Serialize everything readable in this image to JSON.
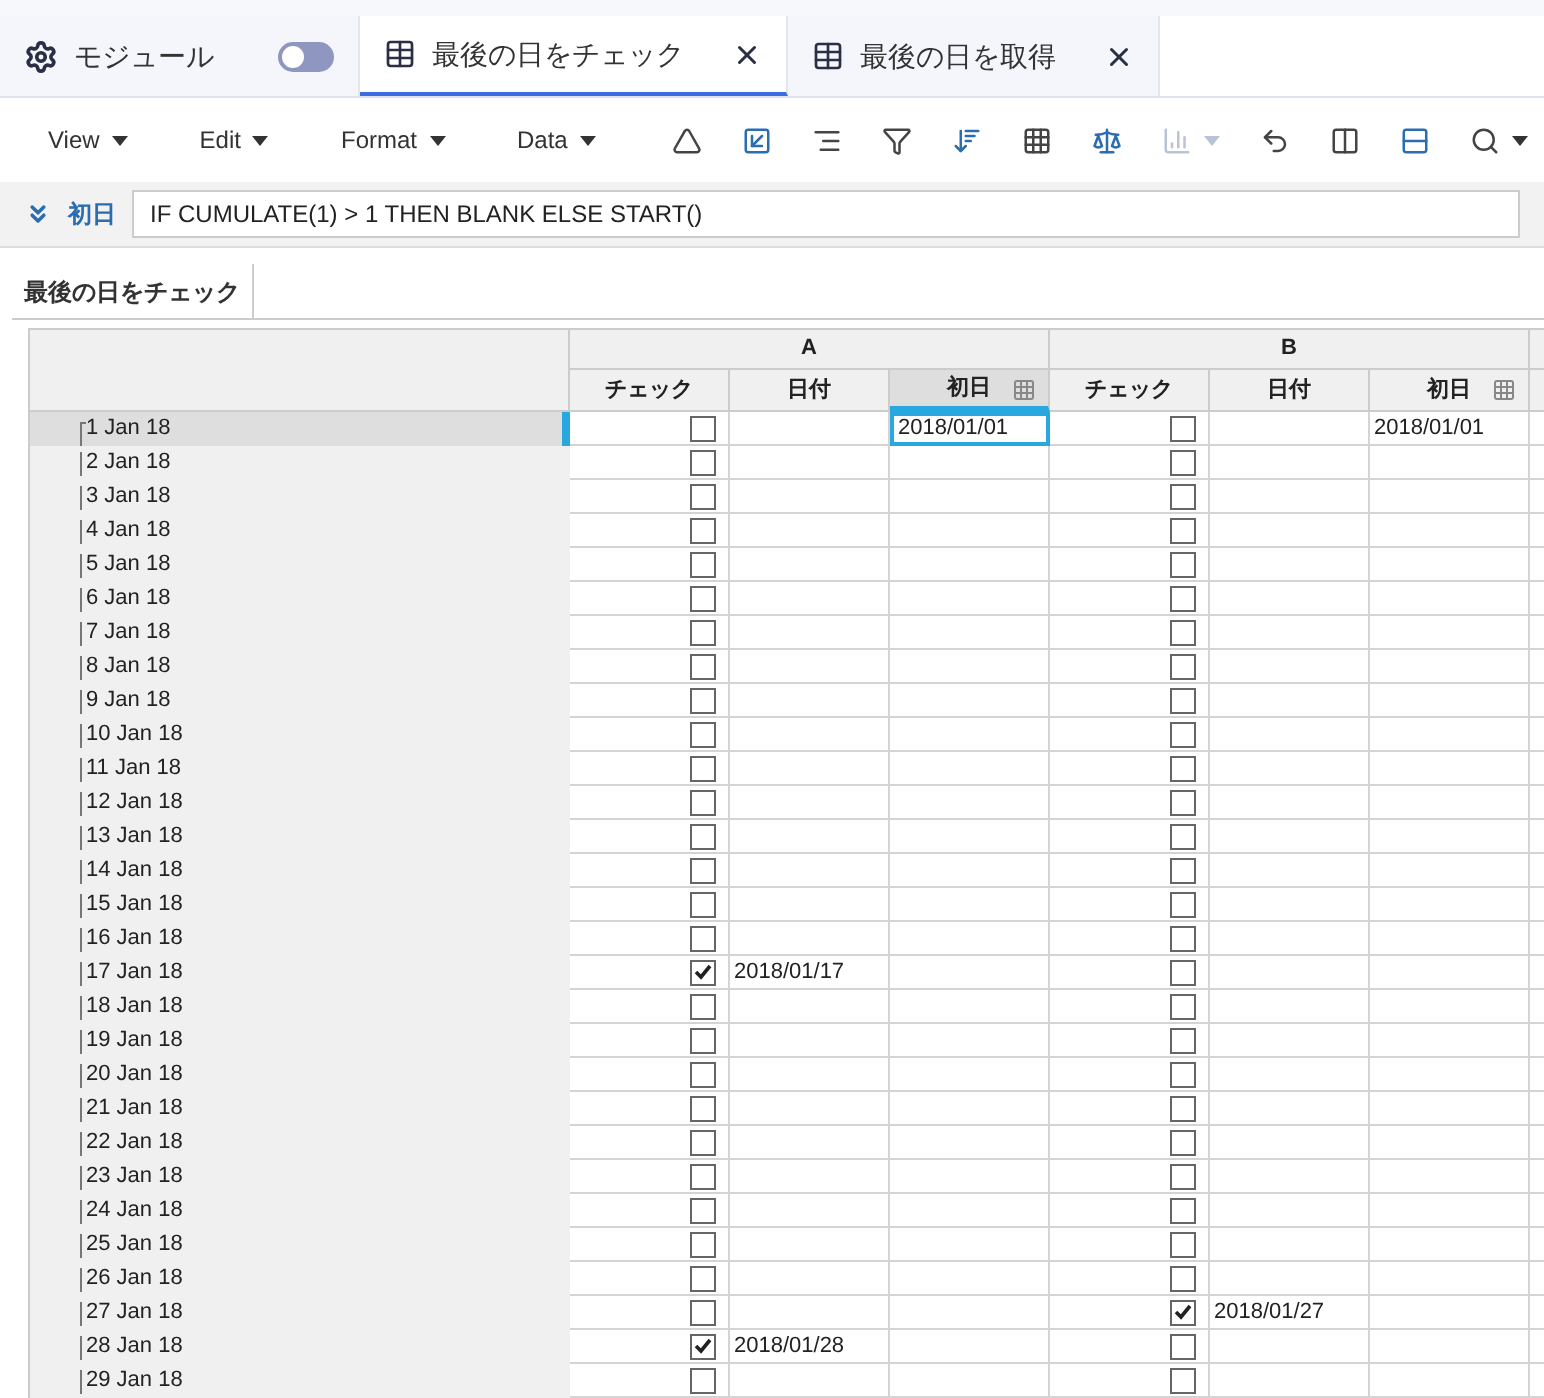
{
  "tabs": [
    {
      "kind": "module",
      "label": "モジュール",
      "toggle_on": false,
      "selected": false
    },
    {
      "kind": "sheet",
      "label": "最後の日をチェック",
      "selected": true
    },
    {
      "kind": "sheet",
      "label": "最後の日を取得",
      "selected": false
    }
  ],
  "menus": [
    "View",
    "Edit",
    "Format",
    "Data"
  ],
  "tools": [
    {
      "kind": "triangle",
      "disabled": false
    },
    {
      "kind": "frame",
      "disabled": false
    },
    {
      "kind": "lines",
      "disabled": false
    },
    {
      "kind": "filter",
      "disabled": false
    },
    {
      "kind": "sort",
      "disabled": false
    },
    {
      "kind": "grid",
      "disabled": false
    },
    {
      "kind": "scale",
      "disabled": false
    },
    {
      "kind": "chart",
      "disabled": true
    },
    {
      "kind": "undo",
      "disabled": false
    },
    {
      "kind": "column",
      "disabled": false
    },
    {
      "kind": "row",
      "disabled": false
    },
    {
      "kind": "search",
      "disabled": false
    }
  ],
  "formula": {
    "label": "初日",
    "value": "IF CUMULATE(1) > 1 THEN BLANK ELSE START()"
  },
  "sheet_tab": "最後の日をチェック",
  "groups": [
    "A",
    "B"
  ],
  "columns": [
    {
      "label": "チェック",
      "selected": false
    },
    {
      "label": "日付",
      "selected": false
    },
    {
      "label": "初日",
      "selected": true
    },
    {
      "label": "チェック",
      "selected": false
    },
    {
      "label": "日付",
      "selected": false
    },
    {
      "label": "初日",
      "selected": false
    }
  ],
  "rows": [
    {
      "label": "1 Jan 18",
      "selected": true,
      "cells": [
        {
          "kind": "check",
          "checked": false
        },
        {
          "kind": "text",
          "selected": false
        },
        {
          "kind": "text",
          "text": "2018/01/01",
          "selected": true
        },
        {
          "kind": "check",
          "checked": false
        },
        {
          "kind": "text",
          "selected": false
        },
        {
          "kind": "text",
          "text": "2018/01/01",
          "selected": false
        }
      ]
    },
    {
      "label": "2 Jan 18",
      "selected": false,
      "cells": [
        {
          "kind": "check",
          "checked": false
        },
        {
          "kind": "text",
          "selected": false
        },
        {
          "kind": "text",
          "selected": false
        },
        {
          "kind": "check",
          "checked": false
        },
        {
          "kind": "text",
          "selected": false
        },
        {
          "kind": "text",
          "selected": false
        }
      ]
    },
    {
      "label": "3 Jan 18",
      "selected": false,
      "cells": [
        {
          "kind": "check",
          "checked": false
        },
        {
          "kind": "text",
          "selected": false
        },
        {
          "kind": "text",
          "selected": false
        },
        {
          "kind": "check",
          "checked": false
        },
        {
          "kind": "text",
          "selected": false
        },
        {
          "kind": "text",
          "selected": false
        }
      ]
    },
    {
      "label": "4 Jan 18",
      "selected": false,
      "cells": [
        {
          "kind": "check",
          "checked": false
        },
        {
          "kind": "text",
          "selected": false
        },
        {
          "kind": "text",
          "selected": false
        },
        {
          "kind": "check",
          "checked": false
        },
        {
          "kind": "text",
          "selected": false
        },
        {
          "kind": "text",
          "selected": false
        }
      ]
    },
    {
      "label": "5 Jan 18",
      "selected": false,
      "cells": [
        {
          "kind": "check",
          "checked": false
        },
        {
          "kind": "text",
          "selected": false
        },
        {
          "kind": "text",
          "selected": false
        },
        {
          "kind": "check",
          "checked": false
        },
        {
          "kind": "text",
          "selected": false
        },
        {
          "kind": "text",
          "selected": false
        }
      ]
    },
    {
      "label": "6 Jan 18",
      "selected": false,
      "cells": [
        {
          "kind": "check",
          "checked": false
        },
        {
          "kind": "text",
          "selected": false
        },
        {
          "kind": "text",
          "selected": false
        },
        {
          "kind": "check",
          "checked": false
        },
        {
          "kind": "text",
          "selected": false
        },
        {
          "kind": "text",
          "selected": false
        }
      ]
    },
    {
      "label": "7 Jan 18",
      "selected": false,
      "cells": [
        {
          "kind": "check",
          "checked": false
        },
        {
          "kind": "text",
          "selected": false
        },
        {
          "kind": "text",
          "selected": false
        },
        {
          "kind": "check",
          "checked": false
        },
        {
          "kind": "text",
          "selected": false
        },
        {
          "kind": "text",
          "selected": false
        }
      ]
    },
    {
      "label": "8 Jan 18",
      "selected": false,
      "cells": [
        {
          "kind": "check",
          "checked": false
        },
        {
          "kind": "text",
          "selected": false
        },
        {
          "kind": "text",
          "selected": false
        },
        {
          "kind": "check",
          "checked": false
        },
        {
          "kind": "text",
          "selected": false
        },
        {
          "kind": "text",
          "selected": false
        }
      ]
    },
    {
      "label": "9 Jan 18",
      "selected": false,
      "cells": [
        {
          "kind": "check",
          "checked": false
        },
        {
          "kind": "text",
          "selected": false
        },
        {
          "kind": "text",
          "selected": false
        },
        {
          "kind": "check",
          "checked": false
        },
        {
          "kind": "text",
          "selected": false
        },
        {
          "kind": "text",
          "selected": false
        }
      ]
    },
    {
      "label": "10 Jan 18",
      "selected": false,
      "cells": [
        {
          "kind": "check",
          "checked": false
        },
        {
          "kind": "text",
          "selected": false
        },
        {
          "kind": "text",
          "selected": false
        },
        {
          "kind": "check",
          "checked": false
        },
        {
          "kind": "text",
          "selected": false
        },
        {
          "kind": "text",
          "selected": false
        }
      ]
    },
    {
      "label": "11 Jan 18",
      "selected": false,
      "cells": [
        {
          "kind": "check",
          "checked": false
        },
        {
          "kind": "text",
          "selected": false
        },
        {
          "kind": "text",
          "selected": false
        },
        {
          "kind": "check",
          "checked": false
        },
        {
          "kind": "text",
          "selected": false
        },
        {
          "kind": "text",
          "selected": false
        }
      ]
    },
    {
      "label": "12 Jan 18",
      "selected": false,
      "cells": [
        {
          "kind": "check",
          "checked": false
        },
        {
          "kind": "text",
          "selected": false
        },
        {
          "kind": "text",
          "selected": false
        },
        {
          "kind": "check",
          "checked": false
        },
        {
          "kind": "text",
          "selected": false
        },
        {
          "kind": "text",
          "selected": false
        }
      ]
    },
    {
      "label": "13 Jan 18",
      "selected": false,
      "cells": [
        {
          "kind": "check",
          "checked": false
        },
        {
          "kind": "text",
          "selected": false
        },
        {
          "kind": "text",
          "selected": false
        },
        {
          "kind": "check",
          "checked": false
        },
        {
          "kind": "text",
          "selected": false
        },
        {
          "kind": "text",
          "selected": false
        }
      ]
    },
    {
      "label": "14 Jan 18",
      "selected": false,
      "cells": [
        {
          "kind": "check",
          "checked": false
        },
        {
          "kind": "text",
          "selected": false
        },
        {
          "kind": "text",
          "selected": false
        },
        {
          "kind": "check",
          "checked": false
        },
        {
          "kind": "text",
          "selected": false
        },
        {
          "kind": "text",
          "selected": false
        }
      ]
    },
    {
      "label": "15 Jan 18",
      "selected": false,
      "cells": [
        {
          "kind": "check",
          "checked": false
        },
        {
          "kind": "text",
          "selected": false
        },
        {
          "kind": "text",
          "selected": false
        },
        {
          "kind": "check",
          "checked": false
        },
        {
          "kind": "text",
          "selected": false
        },
        {
          "kind": "text",
          "selected": false
        }
      ]
    },
    {
      "label": "16 Jan 18",
      "selected": false,
      "cells": [
        {
          "kind": "check",
          "checked": false
        },
        {
          "kind": "text",
          "selected": false
        },
        {
          "kind": "text",
          "selected": false
        },
        {
          "kind": "check",
          "checked": false
        },
        {
          "kind": "text",
          "selected": false
        },
        {
          "kind": "text",
          "selected": false
        }
      ]
    },
    {
      "label": "17 Jan 18",
      "selected": false,
      "cells": [
        {
          "kind": "check",
          "checked": true
        },
        {
          "kind": "text",
          "text": "2018/01/17",
          "selected": false
        },
        {
          "kind": "text",
          "selected": false
        },
        {
          "kind": "check",
          "checked": false
        },
        {
          "kind": "text",
          "selected": false
        },
        {
          "kind": "text",
          "selected": false
        }
      ]
    },
    {
      "label": "18 Jan 18",
      "selected": false,
      "cells": [
        {
          "kind": "check",
          "checked": false
        },
        {
          "kind": "text",
          "selected": false
        },
        {
          "kind": "text",
          "selected": false
        },
        {
          "kind": "check",
          "checked": false
        },
        {
          "kind": "text",
          "selected": false
        },
        {
          "kind": "text",
          "selected": false
        }
      ]
    },
    {
      "label": "19 Jan 18",
      "selected": false,
      "cells": [
        {
          "kind": "check",
          "checked": false
        },
        {
          "kind": "text",
          "selected": false
        },
        {
          "kind": "text",
          "selected": false
        },
        {
          "kind": "check",
          "checked": false
        },
        {
          "kind": "text",
          "selected": false
        },
        {
          "kind": "text",
          "selected": false
        }
      ]
    },
    {
      "label": "20 Jan 18",
      "selected": false,
      "cells": [
        {
          "kind": "check",
          "checked": false
        },
        {
          "kind": "text",
          "selected": false
        },
        {
          "kind": "text",
          "selected": false
        },
        {
          "kind": "check",
          "checked": false
        },
        {
          "kind": "text",
          "selected": false
        },
        {
          "kind": "text",
          "selected": false
        }
      ]
    },
    {
      "label": "21 Jan 18",
      "selected": false,
      "cells": [
        {
          "kind": "check",
          "checked": false
        },
        {
          "kind": "text",
          "selected": false
        },
        {
          "kind": "text",
          "selected": false
        },
        {
          "kind": "check",
          "checked": false
        },
        {
          "kind": "text",
          "selected": false
        },
        {
          "kind": "text",
          "selected": false
        }
      ]
    },
    {
      "label": "22 Jan 18",
      "selected": false,
      "cells": [
        {
          "kind": "check",
          "checked": false
        },
        {
          "kind": "text",
          "selected": false
        },
        {
          "kind": "text",
          "selected": false
        },
        {
          "kind": "check",
          "checked": false
        },
        {
          "kind": "text",
          "selected": false
        },
        {
          "kind": "text",
          "selected": false
        }
      ]
    },
    {
      "label": "23 Jan 18",
      "selected": false,
      "cells": [
        {
          "kind": "check",
          "checked": false
        },
        {
          "kind": "text",
          "selected": false
        },
        {
          "kind": "text",
          "selected": false
        },
        {
          "kind": "check",
          "checked": false
        },
        {
          "kind": "text",
          "selected": false
        },
        {
          "kind": "text",
          "selected": false
        }
      ]
    },
    {
      "label": "24 Jan 18",
      "selected": false,
      "cells": [
        {
          "kind": "check",
          "checked": false
        },
        {
          "kind": "text",
          "selected": false
        },
        {
          "kind": "text",
          "selected": false
        },
        {
          "kind": "check",
          "checked": false
        },
        {
          "kind": "text",
          "selected": false
        },
        {
          "kind": "text",
          "selected": false
        }
      ]
    },
    {
      "label": "25 Jan 18",
      "selected": false,
      "cells": [
        {
          "kind": "check",
          "checked": false
        },
        {
          "kind": "text",
          "selected": false
        },
        {
          "kind": "text",
          "selected": false
        },
        {
          "kind": "check",
          "checked": false
        },
        {
          "kind": "text",
          "selected": false
        },
        {
          "kind": "text",
          "selected": false
        }
      ]
    },
    {
      "label": "26 Jan 18",
      "selected": false,
      "cells": [
        {
          "kind": "check",
          "checked": false
        },
        {
          "kind": "text",
          "selected": false
        },
        {
          "kind": "text",
          "selected": false
        },
        {
          "kind": "check",
          "checked": false
        },
        {
          "kind": "text",
          "selected": false
        },
        {
          "kind": "text",
          "selected": false
        }
      ]
    },
    {
      "label": "27 Jan 18",
      "selected": false,
      "cells": [
        {
          "kind": "check",
          "checked": false
        },
        {
          "kind": "text",
          "selected": false
        },
        {
          "kind": "text",
          "selected": false
        },
        {
          "kind": "check",
          "checked": true
        },
        {
          "kind": "text",
          "text": "2018/01/27",
          "selected": false
        },
        {
          "kind": "text",
          "selected": false
        }
      ]
    },
    {
      "label": "28 Jan 18",
      "selected": false,
      "cells": [
        {
          "kind": "check",
          "checked": true
        },
        {
          "kind": "text",
          "text": "2018/01/28",
          "selected": false
        },
        {
          "kind": "text",
          "selected": false
        },
        {
          "kind": "check",
          "checked": false
        },
        {
          "kind": "text",
          "selected": false
        },
        {
          "kind": "text",
          "selected": false
        }
      ]
    },
    {
      "label": "29 Jan 18",
      "selected": false,
      "cells": [
        {
          "kind": "check",
          "checked": false
        },
        {
          "kind": "text",
          "selected": false
        },
        {
          "kind": "text",
          "selected": false
        },
        {
          "kind": "check",
          "checked": false
        },
        {
          "kind": "text",
          "selected": false
        },
        {
          "kind": "text",
          "selected": false
        }
      ]
    }
  ]
}
